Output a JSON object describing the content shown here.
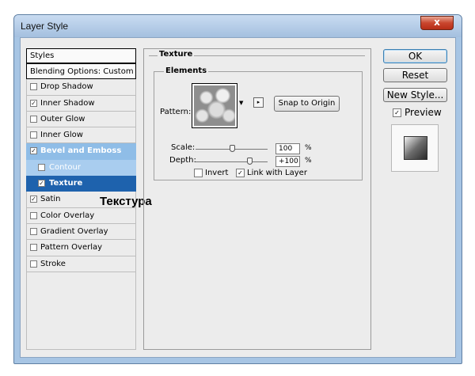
{
  "window": {
    "title": "Layer Style",
    "close_glyph": "x"
  },
  "style_list": {
    "header": "Styles",
    "blending": "Blending Options: Custom",
    "items": [
      {
        "label": "Drop Shadow",
        "checked": false
      },
      {
        "label": "Inner Shadow",
        "checked": true
      },
      {
        "label": "Outer Glow",
        "checked": false
      },
      {
        "label": "Inner Glow",
        "checked": false
      },
      {
        "label": "Bevel and Emboss",
        "checked": true,
        "selected": true
      },
      {
        "label": "Contour",
        "checked": false
      },
      {
        "label": "Texture",
        "checked": true,
        "active": true
      },
      {
        "label": "Satin",
        "checked": true
      },
      {
        "label": "Color Overlay",
        "checked": false
      },
      {
        "label": "Gradient Overlay",
        "checked": false
      },
      {
        "label": "Pattern Overlay",
        "checked": false
      },
      {
        "label": "Stroke",
        "checked": false
      }
    ],
    "annotation": "Текстура"
  },
  "texture": {
    "title": "Texture",
    "elements_title": "Elements",
    "pattern_label": "Pattern:",
    "snap_button": "Snap to Origin",
    "scale_label": "Scale:",
    "scale_value": "100",
    "scale_fraction": 0.5,
    "depth_label": "Depth:",
    "depth_value": "+100",
    "depth_fraction": 0.75,
    "pct": "%",
    "invert_label": "Invert",
    "invert_checked": false,
    "link_label": "Link with Layer",
    "link_checked": true
  },
  "buttons": {
    "ok": "OK",
    "reset": "Reset",
    "new_style": "New Style...",
    "preview_label": "Preview",
    "preview_checked": true
  },
  "colors": {
    "selection": "#8fbde7",
    "active_item": "#1e62ad",
    "close_button": "#c9462e"
  },
  "icons": {
    "checkmark": "✓",
    "dropdown_arrow": "▼",
    "preset_menu": "▸"
  }
}
